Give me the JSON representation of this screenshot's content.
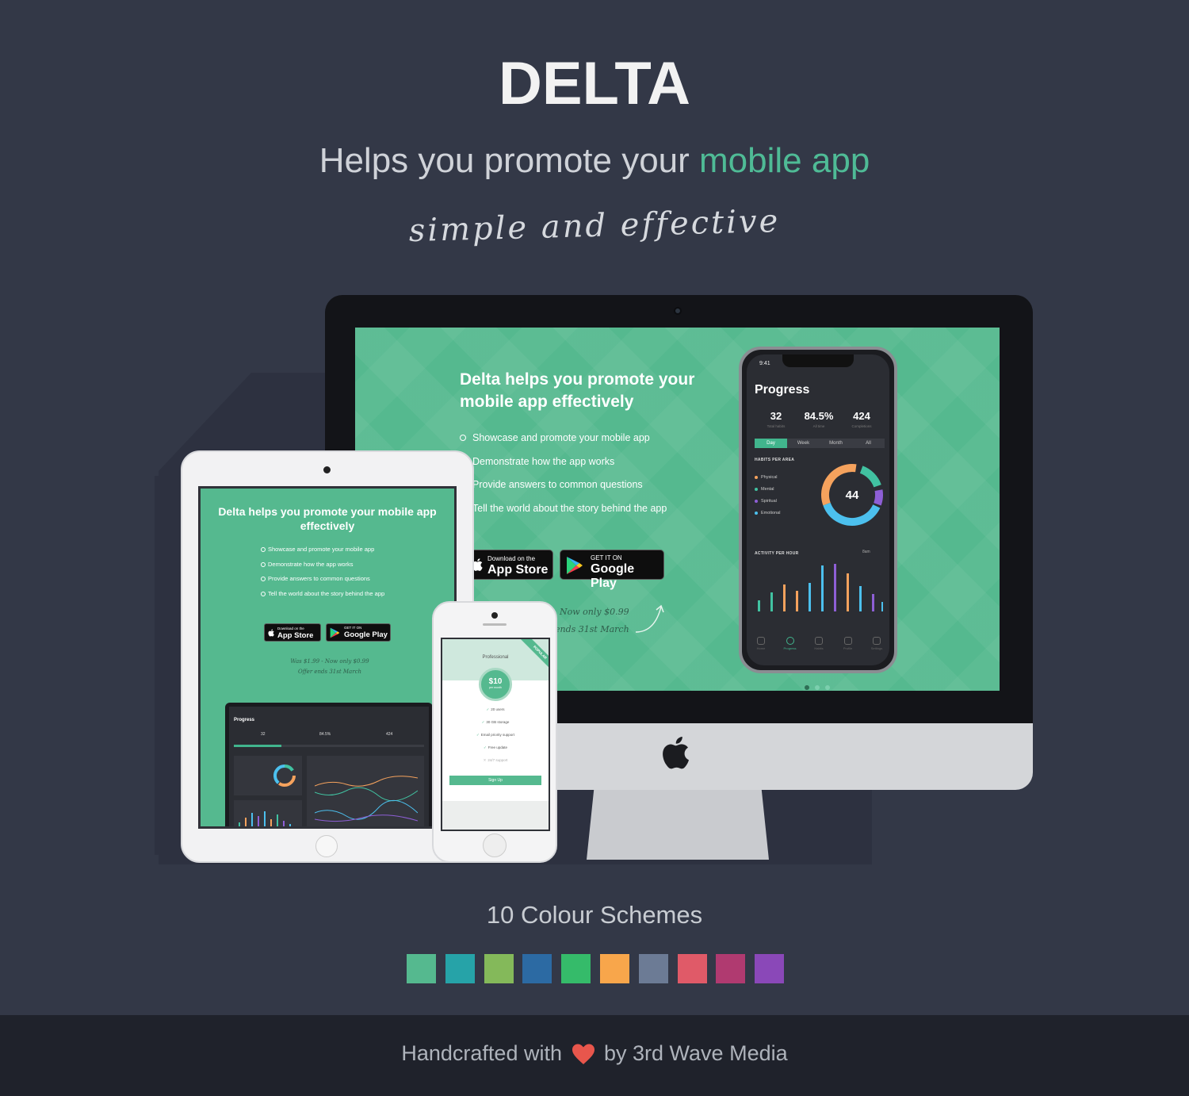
{
  "hero": {
    "title": "DELTA",
    "subtitle_prefix": "Helps you promote your ",
    "subtitle_highlight": "mobile app",
    "tagline": "simple and effective"
  },
  "colors": {
    "background": "#333847",
    "accent": "#55b98f",
    "footer_bg": "#1f222b",
    "heart": "#e8564c"
  },
  "desktop_screen": {
    "headline": "Delta helps you promote your mobile app effectively",
    "features": [
      "Showcase and promote your mobile app",
      "Demonstrate how the app works",
      "Provide answers to common questions",
      "Tell the world about the story behind the app"
    ],
    "app_store": {
      "small": "Download on the",
      "big": "App Store"
    },
    "google_play": {
      "small": "GET IT ON",
      "big": "Google Play"
    },
    "promo_line1": "Now only $0.99",
    "promo_line2": "ends 31st March"
  },
  "phone_app": {
    "time": "9:41",
    "title": "Progress",
    "stats": [
      {
        "value": "32",
        "label": "Total habits"
      },
      {
        "value": "84.5%",
        "label": "All time"
      },
      {
        "value": "424",
        "label": "Completions"
      }
    ],
    "tabs": [
      "Day",
      "Week",
      "Month",
      "All"
    ],
    "active_tab": "Day",
    "habits_heading": "HABITS PER AREA",
    "legend": [
      {
        "name": "Physical",
        "color": "#f5a25d"
      },
      {
        "name": "Mental",
        "color": "#41c2a1"
      },
      {
        "name": "Spiritual",
        "color": "#8e5fd6"
      },
      {
        "name": "Emotional",
        "color": "#4cc0ee"
      }
    ],
    "donut_center": "44",
    "activity_heading": "ACTIVITY PER HOUR",
    "activity_filter": "8am",
    "nav": [
      "Home",
      "Progress",
      "Habits",
      "Profile",
      "Settings"
    ],
    "active_nav": "Progress"
  },
  "ipad_screen": {
    "headline": "Delta helps you promote your mobile app effectively",
    "features": [
      "Showcase and promote your mobile app",
      "Demonstrate how the app works",
      "Provide answers to common questions",
      "Tell the world about the story behind the app"
    ],
    "app_store": {
      "small": "Download on the",
      "big": "App Store"
    },
    "google_play": {
      "small": "GET IT ON",
      "big": "Google Play"
    },
    "promo_line1": "Was $1.99 - Now only $0.99",
    "promo_line2": "Offer ends 31st March",
    "laptop_title": "Progress",
    "laptop_stats": [
      "32",
      "84.5%",
      "424"
    ]
  },
  "iphone_screen": {
    "plan": "Professional",
    "ribbon": "POPULAR",
    "price": "$10",
    "price_period": "per month",
    "features": [
      {
        "text": "20 users",
        "included": true
      },
      {
        "text": "30 GB storage",
        "included": true
      },
      {
        "text": "Email priority support",
        "included": true
      },
      {
        "text": "Free update",
        "included": true
      },
      {
        "text": "24/7 support",
        "included": false
      }
    ],
    "cta": "Sign Up"
  },
  "schemes": {
    "title": "10 Colour Schemes",
    "colors": [
      "#55b98f",
      "#26a3a8",
      "#84b95a",
      "#2c6aa3",
      "#35bb6a",
      "#f8a64b",
      "#6c7b95",
      "#e05a68",
      "#b03a70",
      "#8a48b8"
    ]
  },
  "footer": {
    "prefix": "Handcrafted with",
    "suffix": "by 3rd Wave Media"
  }
}
